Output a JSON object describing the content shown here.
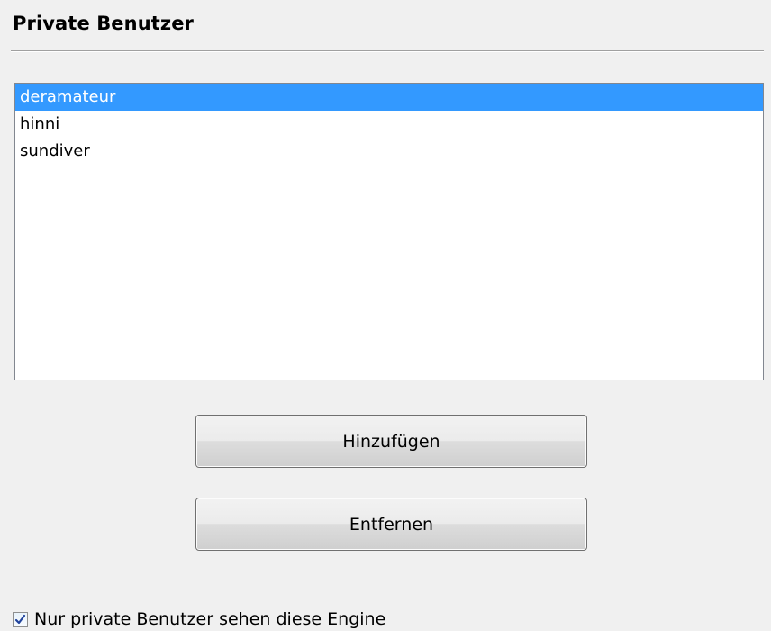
{
  "section": {
    "title": "Private Benutzer"
  },
  "users": {
    "items": [
      {
        "label": "deramateur",
        "selected": true
      },
      {
        "label": "hinni",
        "selected": false
      },
      {
        "label": "sundiver",
        "selected": false
      }
    ]
  },
  "buttons": {
    "add_label": "Hinzufügen",
    "remove_label": "Entfernen"
  },
  "options": {
    "private_only_label": "Nur private Benutzer sehen diese Engine",
    "private_only_checked": true
  },
  "colors": {
    "selection": "#3399ff",
    "window_background": "#f0f0f0"
  }
}
